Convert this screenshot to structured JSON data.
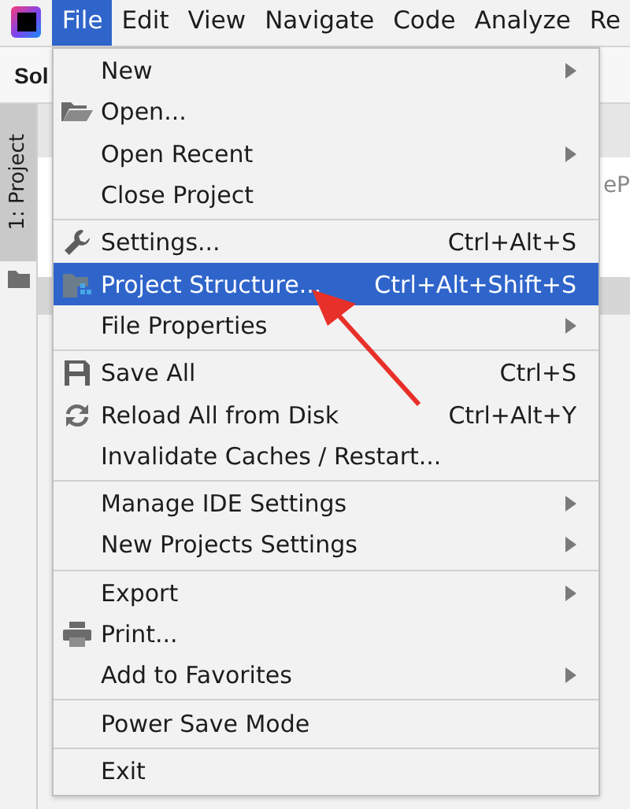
{
  "menu_bar": [
    {
      "label": "File",
      "selected": true
    },
    {
      "label": "Edit",
      "selected": false
    },
    {
      "label": "View",
      "selected": false
    },
    {
      "label": "Navigate",
      "selected": false
    },
    {
      "label": "Code",
      "selected": false
    },
    {
      "label": "Analyze",
      "selected": false
    },
    {
      "label": "Re",
      "selected": false
    }
  ],
  "toolbar": {
    "title": "Sol"
  },
  "tool_strip": {
    "tab": {
      "label": "1: Project",
      "selected": true
    }
  },
  "editor": {
    "text": "eP"
  },
  "file_menu": [
    {
      "kind": "item",
      "label": "New",
      "has_submenu": true,
      "selected": false
    },
    {
      "kind": "item",
      "label": "Open...",
      "has_submenu": false,
      "selected": false
    },
    {
      "kind": "item",
      "label": "Open Recent",
      "has_submenu": true,
      "selected": false
    },
    {
      "kind": "item",
      "label": "Close Project",
      "has_submenu": false,
      "selected": false
    },
    {
      "kind": "separator"
    },
    {
      "kind": "item",
      "label": "Settings...",
      "shortcut": "Ctrl+Alt+S",
      "has_submenu": false,
      "selected": false
    },
    {
      "kind": "item",
      "label": "Project Structure...",
      "shortcut": "Ctrl+Alt+Shift+S",
      "has_submenu": false,
      "selected": true
    },
    {
      "kind": "item",
      "label": "File Properties",
      "has_submenu": true,
      "selected": false
    },
    {
      "kind": "separator"
    },
    {
      "kind": "item",
      "label": "Save All",
      "shortcut": "Ctrl+S",
      "has_submenu": false,
      "selected": false
    },
    {
      "kind": "item",
      "label": "Reload All from Disk",
      "shortcut": "Ctrl+Alt+Y",
      "has_submenu": false,
      "selected": false
    },
    {
      "kind": "item",
      "label": "Invalidate Caches / Restart...",
      "has_submenu": false,
      "selected": false
    },
    {
      "kind": "separator"
    },
    {
      "kind": "item",
      "label": "Manage IDE Settings",
      "has_submenu": true,
      "selected": false
    },
    {
      "kind": "item",
      "label": "New Projects Settings",
      "has_submenu": true,
      "selected": false
    },
    {
      "kind": "separator"
    },
    {
      "kind": "item",
      "label": "Export",
      "has_submenu": true,
      "selected": false
    },
    {
      "kind": "item",
      "label": "Print...",
      "has_submenu": false,
      "selected": false
    },
    {
      "kind": "item",
      "label": "Add to Favorites",
      "has_submenu": true,
      "selected": false
    },
    {
      "kind": "separator"
    },
    {
      "kind": "item",
      "label": "Power Save Mode",
      "has_submenu": false,
      "selected": false
    },
    {
      "kind": "separator"
    },
    {
      "kind": "item",
      "label": "Exit",
      "has_submenu": false,
      "selected": false
    }
  ]
}
